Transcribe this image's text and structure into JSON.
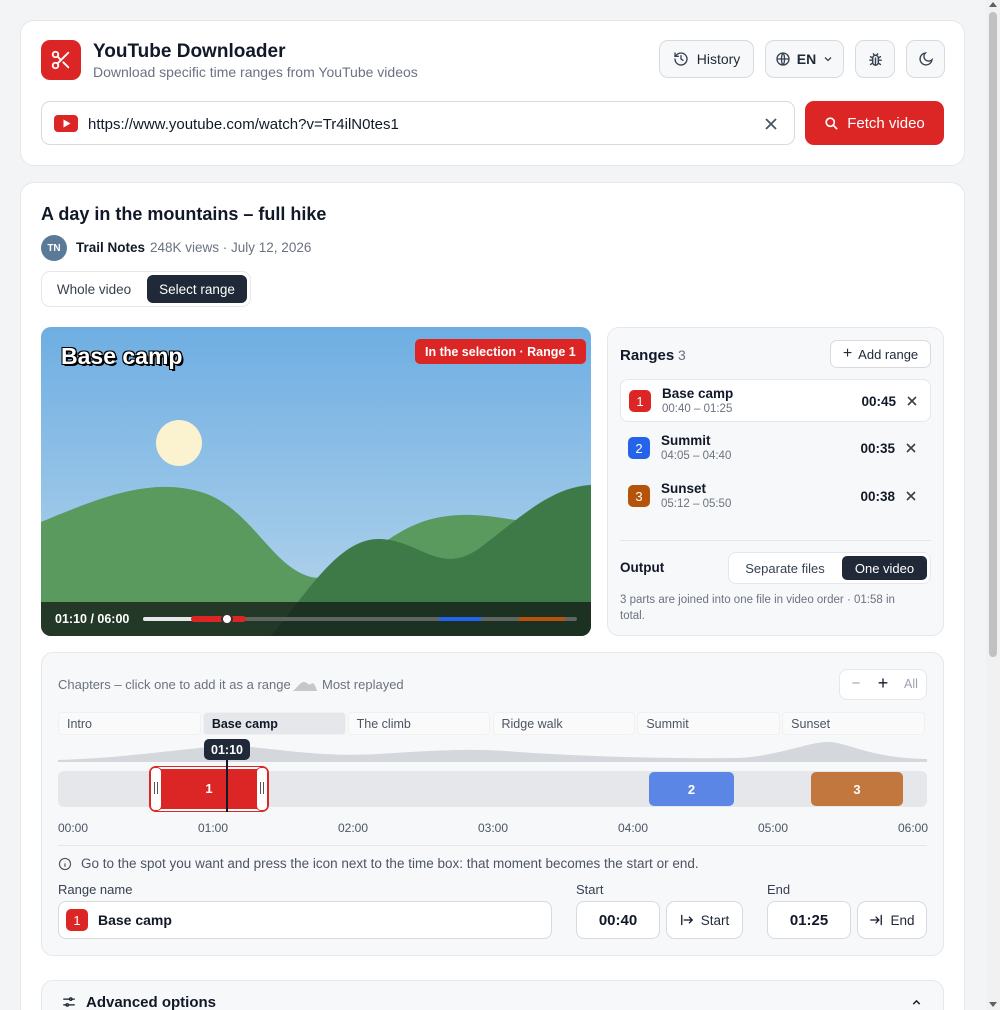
{
  "header": {
    "title": "YouTube Downloader",
    "subtitle": "Download specific time ranges from YouTube videos",
    "history_label": "History",
    "language": "EN"
  },
  "url_bar": {
    "value": "https://www.youtube.com/watch?v=Tr4ilN0tes1",
    "fetch_label": "Fetch video"
  },
  "video": {
    "title": "A day in the mountains – full hike",
    "channel_initials": "TN",
    "channel": "Trail Notes",
    "meta": "248K views · July 12, 2026",
    "mode_whole": "Whole video",
    "mode_range": "Select range",
    "overlay_title": "Base camp",
    "selection_badge": "In the selection · Range 1",
    "time_display": "01:10 / 06:00",
    "progress": 0.194
  },
  "ranges_panel": {
    "title": "Ranges",
    "count": "3",
    "add_label": "Add range",
    "items": [
      {
        "num": "1",
        "name": "Base camp",
        "span": "00:40 – 01:25",
        "duration": "00:45",
        "color": "#dc2626"
      },
      {
        "num": "2",
        "name": "Summit",
        "span": "04:05 – 04:40",
        "duration": "00:35",
        "color": "#2563eb"
      },
      {
        "num": "3",
        "name": "Sunset",
        "span": "05:12 – 05:50",
        "duration": "00:38",
        "color": "#b45309"
      }
    ],
    "output_label": "Output",
    "output_separate": "Separate files",
    "output_one": "One video",
    "output_note": "3 parts are joined into one file in video order · 01:58 in total."
  },
  "timeline": {
    "chapters_hint": "Chapters – click one to add it as a range",
    "most_replayed": "Most replayed",
    "zoom_minus": "−",
    "zoom_plus": "+",
    "zoom_all": "All",
    "chapters": [
      "Intro",
      "Base camp",
      "The climb",
      "Ridge walk",
      "Summit",
      "Sunset"
    ],
    "playhead": "01:10",
    "ticks": [
      "00:00",
      "01:00",
      "02:00",
      "03:00",
      "04:00",
      "05:00",
      "06:00"
    ],
    "segment_labels": [
      "1",
      "2",
      "3"
    ],
    "info": "Go to the spot you want and press the icon next to the time box: that moment becomes the start or end."
  },
  "editor": {
    "range_name_label": "Range name",
    "range_num": "1",
    "range_name": "Base camp",
    "start_label": "Start",
    "start_value": "00:40",
    "start_btn": "Start",
    "end_label": "End",
    "end_value": "01:25",
    "end_btn": "End"
  },
  "advanced": {
    "label": "Advanced options"
  }
}
